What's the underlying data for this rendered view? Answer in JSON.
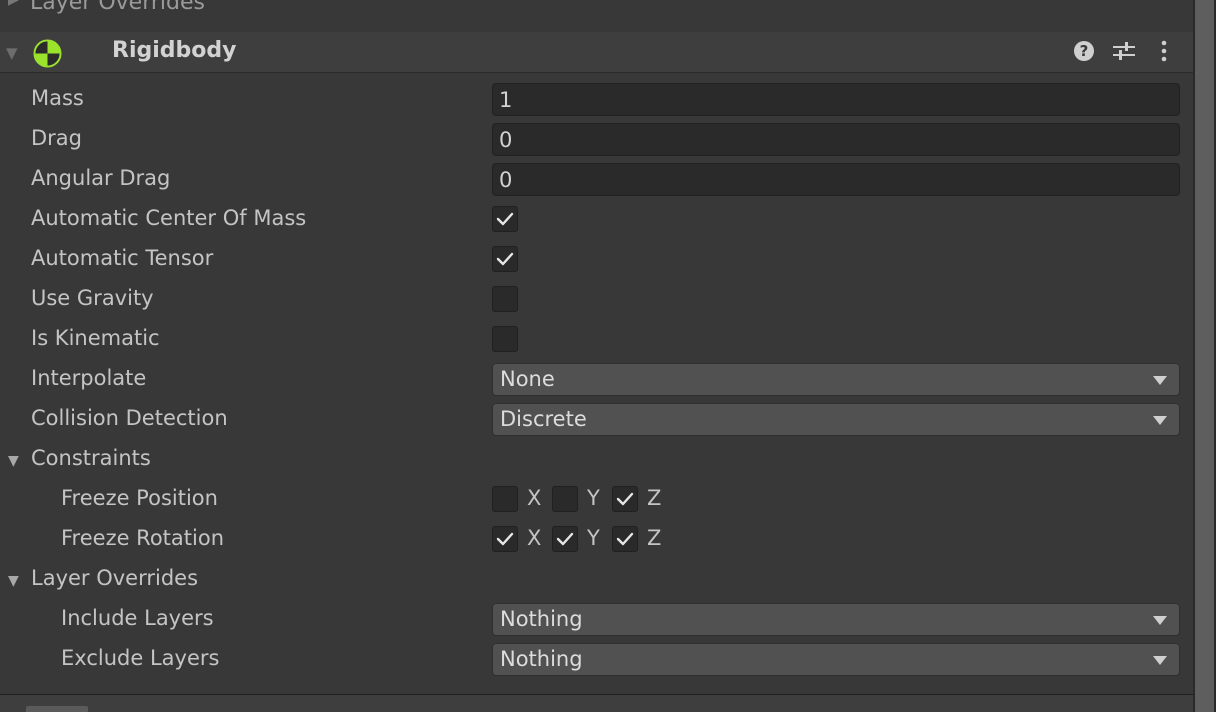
{
  "previous_component": {
    "label": "Layer Overrides"
  },
  "component": {
    "title": "Rigidbody",
    "icon": "rigidbody-icon",
    "icon_colors": {
      "green": "#9be22d",
      "dark": "#2b2b2b"
    },
    "header_buttons": [
      "help-icon",
      "presets-icon",
      "more-options-icon"
    ]
  },
  "fields": {
    "mass": {
      "label": "Mass",
      "value": "1"
    },
    "drag": {
      "label": "Drag",
      "value": "0"
    },
    "angular_drag": {
      "label": "Angular Drag",
      "value": "0"
    },
    "auto_com": {
      "label": "Automatic Center Of Mass",
      "checked": true
    },
    "auto_tensor": {
      "label": "Automatic Tensor",
      "checked": true
    },
    "use_gravity": {
      "label": "Use Gravity",
      "checked": false
    },
    "is_kinematic": {
      "label": "Is Kinematic",
      "checked": false
    },
    "interpolate": {
      "label": "Interpolate",
      "value": "None"
    },
    "collision_detection": {
      "label": "Collision Detection",
      "value": "Discrete"
    }
  },
  "constraints": {
    "label": "Constraints",
    "freeze_position": {
      "label": "Freeze Position",
      "x": false,
      "y": false,
      "z": true
    },
    "freeze_rotation": {
      "label": "Freeze Rotation",
      "x": true,
      "y": true,
      "z": true
    },
    "axes": {
      "x": "X",
      "y": "Y",
      "z": "Z"
    }
  },
  "layer_overrides": {
    "label": "Layer Overrides",
    "include_layers": {
      "label": "Include Layers",
      "value": "Nothing"
    },
    "exclude_layers": {
      "label": "Exclude Layers",
      "value": "Nothing"
    }
  }
}
